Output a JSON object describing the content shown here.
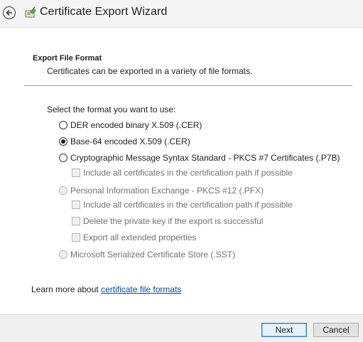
{
  "window": {
    "title": "Certificate Export Wizard"
  },
  "header": {
    "section_title": "Export File Format",
    "section_desc": "Certificates can be exported in a variety of file formats."
  },
  "prompt": "Select the format you want to use:",
  "formats": {
    "der": {
      "label": "DER encoded binary X.509 (.CER)",
      "selected": false,
      "enabled": true
    },
    "base64": {
      "label": "Base-64 encoded X.509 (.CER)",
      "selected": true,
      "enabled": true
    },
    "pkcs7": {
      "label": "Cryptographic Message Syntax Standard - PKCS #7 Certificates (.P7B)",
      "selected": false,
      "enabled": true
    },
    "pkcs7_include": {
      "label": "Include all certificates in the certification path if possible",
      "checked": false,
      "enabled": false
    },
    "pfx": {
      "label": "Personal Information Exchange - PKCS #12 (.PFX)",
      "selected": false,
      "enabled": false
    },
    "pfx_include": {
      "label": "Include all certificates in the certification path if possible",
      "checked": false,
      "enabled": false
    },
    "pfx_delete": {
      "label": "Delete the private key if the export is successful",
      "checked": false,
      "enabled": false
    },
    "pfx_extended": {
      "label": "Export all extended properties",
      "checked": false,
      "enabled": false
    },
    "sst": {
      "label": "Microsoft Serialized Certificate Store (.SST)",
      "selected": false,
      "enabled": false
    }
  },
  "learn_more": {
    "prefix": "Learn more about ",
    "link": "certificate file formats"
  },
  "footer": {
    "next_label": "Next",
    "cancel_label": "Cancel"
  },
  "icons": {
    "back": "back-arrow-icon",
    "app": "certificate-icon"
  },
  "colors": {
    "link": "#0645ad",
    "default_button_border": "#3c7fb1"
  }
}
